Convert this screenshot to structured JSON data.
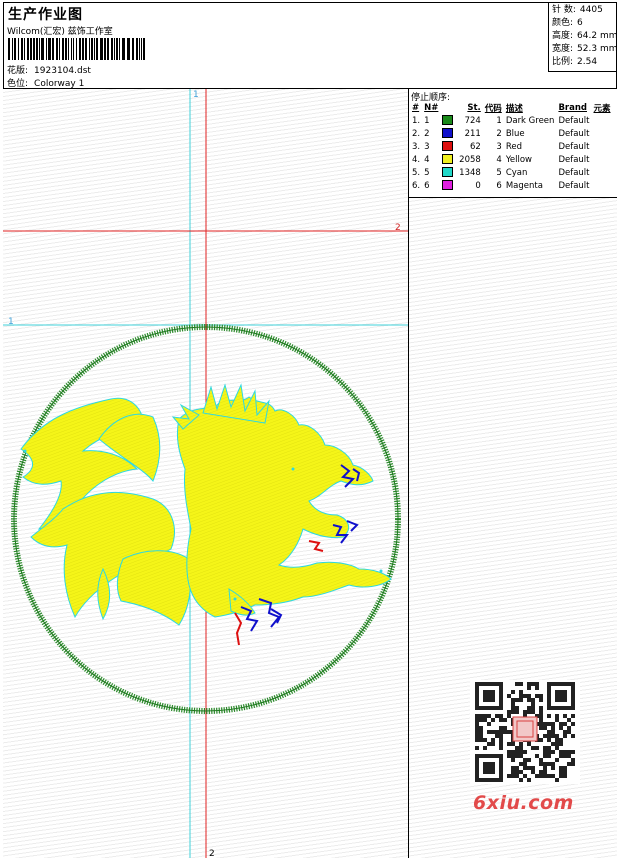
{
  "header": {
    "title": "生产作业图",
    "company": "Wilcom(汇宏) 兹饰工作室",
    "design_label": "花版:",
    "design_value": "1923104.dst",
    "colorway_label": "色位:",
    "colorway_value": "Colorway 1"
  },
  "stats": [
    {
      "label": "针 数:",
      "value": "4405"
    },
    {
      "label": "颜色:",
      "value": "6"
    },
    {
      "label": "高度:",
      "value": "64.2 mm"
    },
    {
      "label": "宽度:",
      "value": "52.3 mm"
    },
    {
      "label": "比例:",
      "value": "2.54"
    }
  ],
  "guides": {
    "vertical_label_top": "1",
    "vertical_label_bottom": "2",
    "horizontal_label_right": "2",
    "horizontal_label_left": "1"
  },
  "stop_sequence": {
    "title": "停止顺序:",
    "headers": [
      "#",
      "N#",
      "St.",
      "代码",
      "描述",
      "Brand",
      "元素"
    ],
    "rows": [
      {
        "idx": "1.",
        "n": "1",
        "color": "#1a8a1a",
        "st": "724",
        "code": "1",
        "desc": "Dark Green",
        "brand": "Default"
      },
      {
        "idx": "2.",
        "n": "2",
        "color": "#1010cc",
        "st": "211",
        "code": "2",
        "desc": "Blue",
        "brand": "Default"
      },
      {
        "idx": "3.",
        "n": "3",
        "color": "#dd1010",
        "st": "62",
        "code": "3",
        "desc": "Red",
        "brand": "Default"
      },
      {
        "idx": "4.",
        "n": "4",
        "color": "#f0f020",
        "st": "2058",
        "code": "4",
        "desc": "Yellow",
        "brand": "Default"
      },
      {
        "idx": "5.",
        "n": "5",
        "color": "#20d8c8",
        "st": "1348",
        "code": "5",
        "desc": "Cyan",
        "brand": "Default"
      },
      {
        "idx": "6.",
        "n": "6",
        "color": "#e020e0",
        "st": "0",
        "code": "6",
        "desc": "Magenta",
        "brand": "Default"
      }
    ]
  },
  "watermark": {
    "text": "6xiu.com"
  }
}
